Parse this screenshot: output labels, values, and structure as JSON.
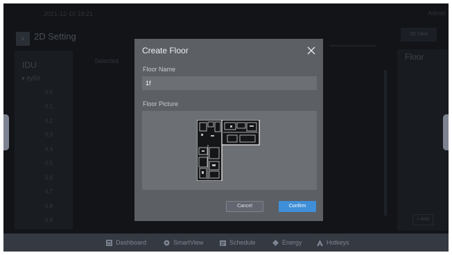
{
  "topbar": {
    "datetime": "2021-12-10  18:21",
    "user": "Admin"
  },
  "page": {
    "title": "2D Setting",
    "view_button": "3D View"
  },
  "idu": {
    "heading": "IDU",
    "group": "tty50",
    "items": [
      "0.0",
      "0.1",
      "0.2",
      "0.3",
      "0.4",
      "0.5",
      "0.6",
      "0.7",
      "0.8",
      "0.9"
    ]
  },
  "selected_label": "Selected",
  "floor_panel": {
    "heading": "Floor",
    "add_label": "+ Add"
  },
  "nav": {
    "items": [
      "Dashboard",
      "SmartView",
      "Schedule",
      "Energy",
      "Hotkeys"
    ]
  },
  "modal": {
    "title": "Create Floor",
    "name_label": "Floor Name",
    "name_value": "1f",
    "picture_label": "Floor Picture",
    "cancel_label": "Cancel",
    "confirm_label": "Confirm"
  },
  "icons": [
    "back-arrow-icon",
    "close-icon",
    "dashboard-icon",
    "smartview-icon",
    "schedule-icon",
    "energy-icon",
    "hotkeys-icon",
    "floor-plan-image"
  ],
  "colors": {
    "confirm": "#3f8fd8",
    "modal_bg": "#5c5f64",
    "nav_bar": "#353a42"
  }
}
